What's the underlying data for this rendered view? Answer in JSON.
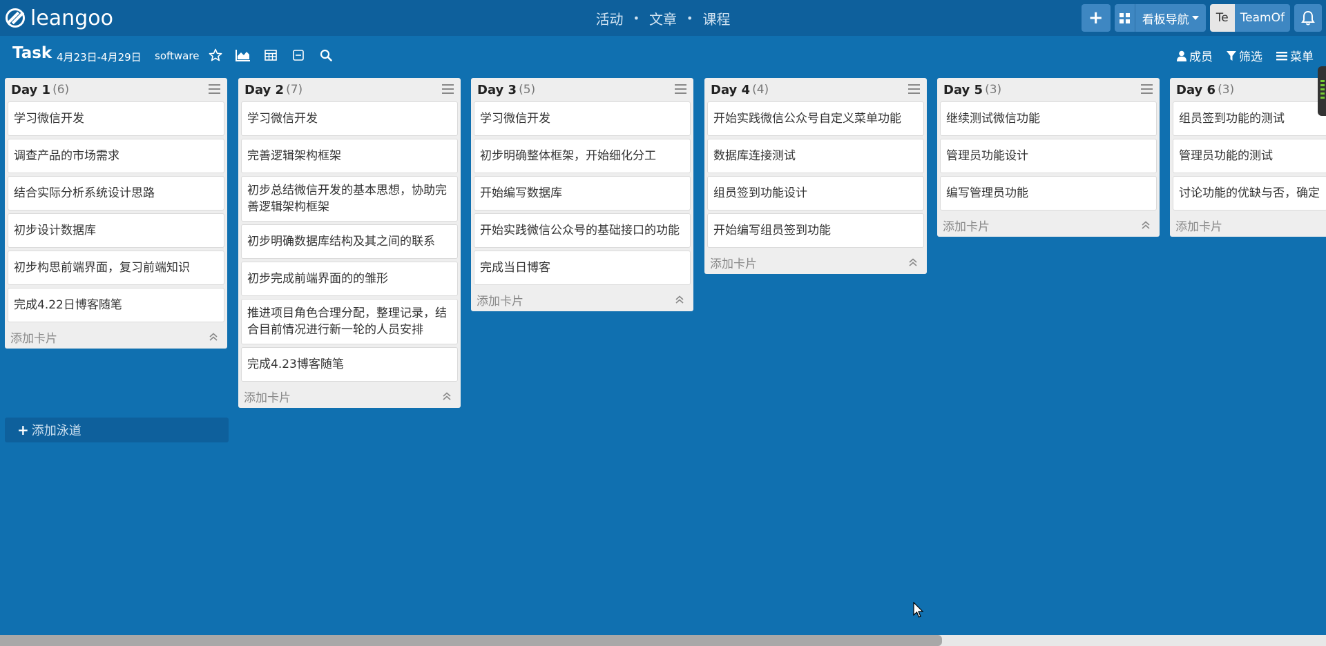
{
  "app": {
    "logo_text": "leangoo",
    "center_nav": [
      "活动",
      "文章",
      "课程"
    ],
    "board_nav_label": "看板导航",
    "user_initials": "Te",
    "team_label": "TeamOf"
  },
  "board": {
    "title": "Task",
    "date_range": "4月23日-4月29日",
    "tag": "software",
    "actions": {
      "members": "成员",
      "filter": "筛选",
      "menu": "菜单"
    }
  },
  "lists": [
    {
      "title": "Day 1",
      "count": "(6)",
      "cards": [
        "学习微信开发",
        "调查产品的市场需求",
        "结合实际分析系统设计思路",
        "初步设计数据库",
        "初步构思前端界面，复习前端知识",
        "完成4.22日博客随笔"
      ],
      "add_label": "添加卡片"
    },
    {
      "title": "Day 2",
      "count": "(7)",
      "cards": [
        "学习微信开发",
        "完善逻辑架构框架",
        "初步总结微信开发的基本思想，协助完善逻辑架构框架",
        "初步明确数据库结构及其之间的联系",
        "初步完成前端界面的的雏形",
        "推进项目角色合理分配，整理记录，结合目前情况进行新一轮的人员安排",
        "完成4.23博客随笔"
      ],
      "add_label": "添加卡片"
    },
    {
      "title": "Day 3",
      "count": "(5)",
      "cards": [
        "学习微信开发",
        "初步明确整体框架，开始细化分工",
        "开始编写数据库",
        "开始实践微信公众号的基础接口的功能",
        "完成当日博客"
      ],
      "add_label": "添加卡片"
    },
    {
      "title": "Day 4",
      "count": "(4)",
      "cards": [
        "开始实践微信公众号自定义菜单功能",
        "数据库连接测试",
        "组员签到功能设计",
        "开始编写组员签到功能"
      ],
      "add_label": "添加卡片"
    },
    {
      "title": "Day 5",
      "count": "(3)",
      "cards": [
        "继续测试微信功能",
        "管理员功能设计",
        "编写管理员功能"
      ],
      "add_label": "添加卡片"
    },
    {
      "title": "Day 6",
      "count": "(3)",
      "cards": [
        "组员签到功能的测试",
        "管理员功能的测试",
        "讨论功能的优缺与否，确定"
      ],
      "add_label": "添加卡片"
    }
  ],
  "add_lane_label": "添加泳道"
}
